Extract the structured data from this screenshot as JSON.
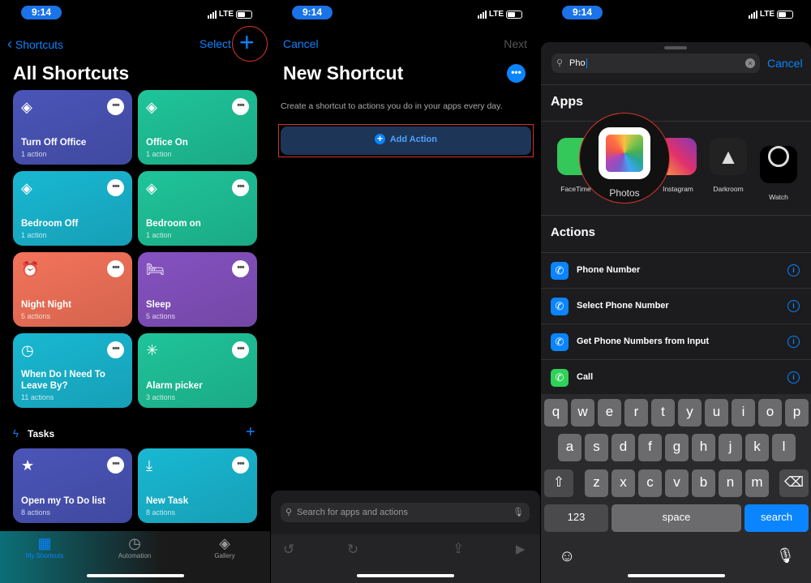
{
  "status": {
    "time": "9:14",
    "network": "LTE"
  },
  "screen1": {
    "back_label": "Shortcuts",
    "select_label": "Select",
    "title": "All Shortcuts",
    "shortcuts": [
      {
        "name": "Turn Off Office",
        "count": "1 action",
        "color": "#4a55b8",
        "icon": "layers-icon"
      },
      {
        "name": "Office On",
        "count": "1 action",
        "color": "#1fc49a",
        "icon": "layers-icon"
      },
      {
        "name": "Bedroom Off",
        "count": "1 action",
        "color": "#19b8d2",
        "icon": "layers-icon"
      },
      {
        "name": "Bedroom on",
        "count": "1 action",
        "color": "#1fc49a",
        "icon": "layers-icon"
      },
      {
        "name": "Night Night",
        "count": "5 actions",
        "color": "#f4735a",
        "icon": "alarm-clock-icon"
      },
      {
        "name": "Sleep",
        "count": "5 actions",
        "color": "#8552c0",
        "icon": "bed-icon"
      },
      {
        "name": "When Do I Need To Leave By?",
        "count": "11 actions",
        "color": "#19b8d2",
        "icon": "clock-icon"
      },
      {
        "name": "Alarm picker",
        "count": "3 actions",
        "color": "#1fc49a",
        "icon": "magic-wand-icon"
      }
    ],
    "section": "Tasks",
    "tasks": [
      {
        "name": "Open my To Do list",
        "count": "8 actions",
        "color": "#4a55b8",
        "icon": "star-icon"
      },
      {
        "name": "New Task",
        "count": "8 actions",
        "color": "#19b8d2",
        "icon": "download-tray-icon"
      }
    ],
    "tabs": [
      {
        "label": "My Shortcuts",
        "active": true
      },
      {
        "label": "Automation"
      },
      {
        "label": "Gallery"
      }
    ]
  },
  "screen2": {
    "cancel_label": "Cancel",
    "next_label": "Next",
    "title": "New Shortcut",
    "description": "Create a shortcut to actions you do in your apps every day.",
    "add_action_label": "Add Action",
    "search_placeholder": "Search for apps and actions"
  },
  "screen3": {
    "search_value": "Pho",
    "cancel_label": "Cancel",
    "apps_heading": "Apps",
    "apps": [
      {
        "label": "FaceTime"
      },
      {
        "label": "Photos"
      },
      {
        "label": "Instagram"
      },
      {
        "label": "Darkroom"
      },
      {
        "label": "Watch"
      }
    ],
    "actions_heading": "Actions",
    "actions": [
      {
        "label": "Phone Number",
        "color": "#0a84ff"
      },
      {
        "label": "Select Phone Number",
        "color": "#0a84ff"
      },
      {
        "label": "Get Phone Numbers from Input",
        "color": "#0a84ff"
      },
      {
        "label": "Call",
        "color": "#30d158"
      }
    ],
    "keyboard": {
      "rows": [
        [
          "q",
          "w",
          "e",
          "r",
          "t",
          "y",
          "u",
          "i",
          "o",
          "p"
        ],
        [
          "a",
          "s",
          "d",
          "f",
          "g",
          "h",
          "j",
          "k",
          "l"
        ],
        [
          "z",
          "x",
          "c",
          "v",
          "b",
          "n",
          "m"
        ]
      ],
      "numbers_label": "123",
      "space_label": "space",
      "search_label": "search"
    }
  },
  "colors": {
    "accent": "#0a84ff",
    "highlight": "#e0382e"
  }
}
